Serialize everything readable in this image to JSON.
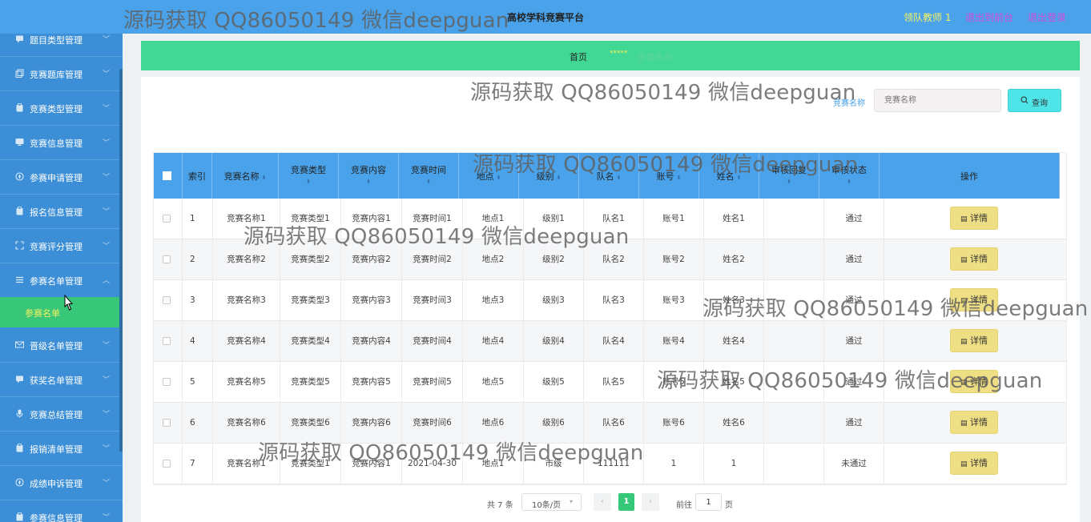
{
  "header": {
    "title": "高校学科竞赛平台",
    "user": "领队教师 1",
    "to_front": "退出到前台",
    "logout": "退出登录"
  },
  "sidebar": {
    "items": [
      {
        "label": "题目类型管理",
        "icon": "chat-icon"
      },
      {
        "label": "竞赛题库管理",
        "icon": "copy-icon"
      },
      {
        "label": "竞赛类型管理",
        "icon": "clipboard-icon"
      },
      {
        "label": "竞赛信息管理",
        "icon": "monitor-icon"
      },
      {
        "label": "参赛申请管理",
        "icon": "compass-icon"
      },
      {
        "label": "报名信息管理",
        "icon": "clipboard-icon"
      },
      {
        "label": "竞赛评分管理",
        "icon": "fullscreen-icon"
      },
      {
        "label": "参赛名单管理",
        "icon": "list-icon"
      },
      {
        "label": "晋级名单管理",
        "icon": "mail-icon"
      },
      {
        "label": "获奖名单管理",
        "icon": "chat-icon"
      },
      {
        "label": "竞赛总结管理",
        "icon": "microphone-icon"
      },
      {
        "label": "报销清单管理",
        "icon": "clipboard-icon"
      },
      {
        "label": "成绩申诉管理",
        "icon": "compass-icon"
      },
      {
        "label": "参赛信息管理",
        "icon": "clipboard-icon"
      }
    ],
    "active_sub": "参赛名单"
  },
  "breadcrumb": {
    "home": "首页",
    "separator": "*****",
    "current": "参赛名单"
  },
  "search": {
    "label": "竞赛名称",
    "placeholder": "竞赛名称",
    "button": "查询"
  },
  "table": {
    "columns": [
      "索引",
      "竞赛名称",
      "竞赛类型",
      "竞赛内容",
      "竞赛时间",
      "地点",
      "级别",
      "队名",
      "账号",
      "姓名",
      "审核回复",
      "审核状态",
      "操作"
    ],
    "rows": [
      {
        "idx": "1",
        "name": "竞赛名称1",
        "type": "竞赛类型1",
        "content": "竞赛内容1",
        "time": "竞赛时间1",
        "place": "地点1",
        "level": "级别1",
        "team": "队名1",
        "account": "账号1",
        "person": "姓名1",
        "reply": "",
        "status": "通过"
      },
      {
        "idx": "2",
        "name": "竞赛名称2",
        "type": "竞赛类型2",
        "content": "竞赛内容2",
        "time": "竞赛时间2",
        "place": "地点2",
        "level": "级别2",
        "team": "队名2",
        "account": "账号2",
        "person": "姓名2",
        "reply": "",
        "status": "通过"
      },
      {
        "idx": "3",
        "name": "竞赛名称3",
        "type": "竞赛类型3",
        "content": "竞赛内容3",
        "time": "竞赛时间3",
        "place": "地点3",
        "level": "级别3",
        "team": "队名3",
        "account": "账号3",
        "person": "姓名3",
        "reply": "",
        "status": "通过"
      },
      {
        "idx": "4",
        "name": "竞赛名称4",
        "type": "竞赛类型4",
        "content": "竞赛内容4",
        "time": "竞赛时间4",
        "place": "地点4",
        "level": "级别4",
        "team": "队名4",
        "account": "账号4",
        "person": "姓名4",
        "reply": "",
        "status": "通过"
      },
      {
        "idx": "5",
        "name": "竞赛名称5",
        "type": "竞赛类型5",
        "content": "竞赛内容5",
        "time": "竞赛时间5",
        "place": "地点5",
        "level": "级别5",
        "team": "队名5",
        "account": "账号5",
        "person": "姓名5",
        "reply": "",
        "status": "通过"
      },
      {
        "idx": "6",
        "name": "竞赛名称6",
        "type": "竞赛类型6",
        "content": "竞赛内容6",
        "time": "竞赛时间6",
        "place": "地点6",
        "level": "级别6",
        "team": "队名6",
        "account": "账号6",
        "person": "姓名6",
        "reply": "",
        "status": "通过"
      },
      {
        "idx": "7",
        "name": "竞赛名称1",
        "type": "竞赛类型1",
        "content": "竞赛内容1",
        "time": "2021-04-30",
        "place": "地点1",
        "level": "市级",
        "team": "111111",
        "account": "1",
        "person": "1",
        "reply": "",
        "status": "未通过"
      }
    ],
    "detail_label": "详情"
  },
  "pagination": {
    "total": "共 7 条",
    "page_size": "10条/页",
    "current_page": "1",
    "goto": "前往",
    "goto_value": "1",
    "page_unit": "页"
  },
  "watermark": "源码获取 QQ86050149 微信deepguan",
  "colors": {
    "topbar": "#4aa3ea",
    "sidebar": "#3c8fd6",
    "active": "#38c678",
    "breadcrumb": "#41d895",
    "detail_button": "#efdf84",
    "search_button": "#4fe5e8"
  }
}
